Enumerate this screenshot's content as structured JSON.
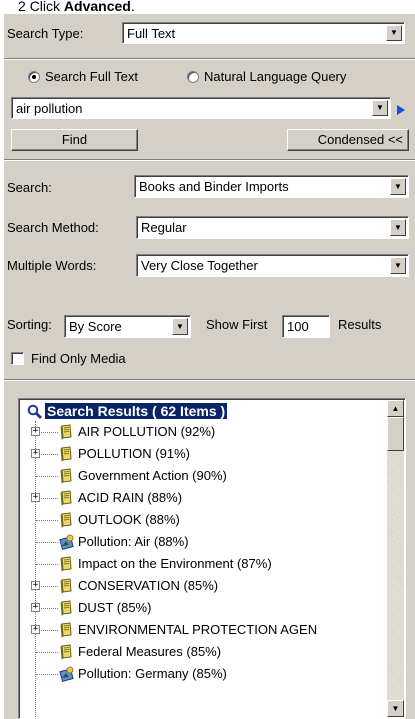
{
  "caption": {
    "step": "2",
    "prefix": "Click ",
    "emph": "Advanced",
    "suffix": "."
  },
  "search_type": {
    "label": "Search Type:",
    "value": "Full Text"
  },
  "mode": {
    "option_full_text": "Search Full Text",
    "option_natural": "Natural Language Query",
    "selected": "Search Full Text"
  },
  "query": {
    "value": "air pollution"
  },
  "buttons": {
    "find": "Find",
    "condensed": "Condensed <<"
  },
  "search": {
    "label": "Search:",
    "value": "Books and Binder Imports"
  },
  "method": {
    "label": "Search Method:",
    "value": "Regular"
  },
  "multiple_words": {
    "label": "Multiple Words:",
    "value": "Very Close Together"
  },
  "sorting": {
    "label": "Sorting:",
    "value": "By Score",
    "show_first_label": "Show First",
    "show_first_value": "100",
    "results_label": "Results"
  },
  "find_only_media": {
    "label": "Find Only Media",
    "checked": false
  },
  "results": {
    "header": "Search Results ( 62 Items )",
    "items": [
      {
        "text": "AIR POLLUTION (92%)",
        "expandable": true,
        "icon": "book-icon"
      },
      {
        "text": "POLLUTION (91%)",
        "expandable": true,
        "icon": "book-icon"
      },
      {
        "text": "Government Action (90%)",
        "expandable": false,
        "icon": "book-icon"
      },
      {
        "text": "ACID RAIN (88%)",
        "expandable": true,
        "icon": "book-icon"
      },
      {
        "text": "OUTLOOK (88%)",
        "expandable": false,
        "icon": "book-icon"
      },
      {
        "text": "Pollution: Air (88%)",
        "expandable": false,
        "icon": "media-icon"
      },
      {
        "text": "Impact on the Environment (87%)",
        "expandable": false,
        "icon": "book-icon"
      },
      {
        "text": "CONSERVATION (85%)",
        "expandable": true,
        "icon": "book-icon"
      },
      {
        "text": "DUST (85%)",
        "expandable": true,
        "icon": "book-icon"
      },
      {
        "text": "ENVIRONMENTAL PROTECTION AGEN",
        "expandable": true,
        "icon": "book-icon"
      },
      {
        "text": "Federal Measures (85%)",
        "expandable": false,
        "icon": "book-icon"
      },
      {
        "text": "Pollution: Germany (85%)",
        "expandable": false,
        "icon": "media-icon"
      }
    ]
  }
}
